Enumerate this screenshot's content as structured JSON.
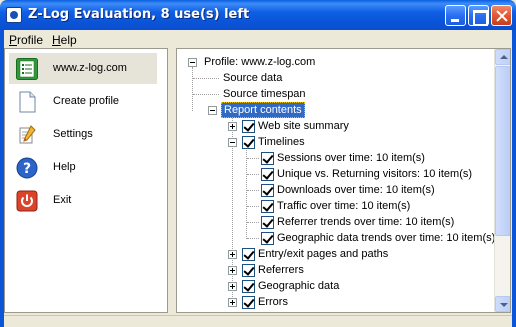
{
  "window": {
    "title": "Z-Log Evaluation, 8 use(s) left"
  },
  "menu": [
    {
      "label": "Profile",
      "underline": "P",
      "rest": "rofile"
    },
    {
      "label": "Help",
      "underline": "H",
      "rest": "elp"
    }
  ],
  "sidebar": {
    "items": [
      {
        "label": "www.z-log.com",
        "icon": "profile-list-icon",
        "selected": true
      },
      {
        "label": "Create profile",
        "icon": "document-icon",
        "selected": false
      },
      {
        "label": "Settings",
        "icon": "settings-icon",
        "selected": false
      },
      {
        "label": "Help",
        "icon": "help-icon",
        "selected": false
      },
      {
        "label": "Exit",
        "icon": "exit-icon",
        "selected": false
      }
    ]
  },
  "tree": {
    "root": "Profile: www.z-log.com",
    "source_data": "Source data",
    "source_timespan": "Source timespan",
    "report_contents": "Report contents",
    "web_site_summary": "Web site summary",
    "timelines": "Timelines",
    "timeline_items": [
      "Sessions over time: 10 item(s)",
      "Unique vs. Returning visitors: 10 item(s)",
      "Downloads over time: 10 item(s)",
      "Traffic over time: 10 item(s)",
      "Referrer trends over time: 10 item(s)",
      "Geographic data trends over time: 10 item(s)"
    ],
    "entry_exit": "Entry/exit pages and paths",
    "referrers": "Referrers",
    "geographic": "Geographic data",
    "errors": "Errors"
  },
  "colors": {
    "titlebar": "#0b55d8",
    "selection": "#316ac5",
    "window_bg": "#ece9d8"
  }
}
